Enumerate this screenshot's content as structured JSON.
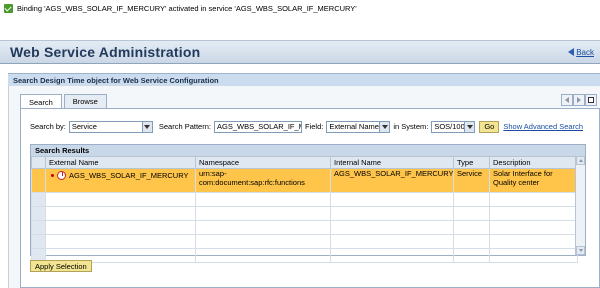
{
  "status": {
    "message": "Binding 'AGS_WBS_SOLAR_IF_MERCURY' activated in service 'AGS_WBS_SOLAR_IF_MERCURY'"
  },
  "header": {
    "title": "Web Service Administration",
    "back_label": "Back"
  },
  "section": {
    "title": "Search Design Time object for Web Service Configuration"
  },
  "tabs": [
    {
      "label": "Search"
    },
    {
      "label": "Browse"
    }
  ],
  "search": {
    "search_by_label": "Search by:",
    "search_by_value": "Service",
    "pattern_label": "Search Pattern:",
    "pattern_value": "AGS_WBS_SOLAR_IF_M",
    "field_label": "Field:",
    "field_value": "External Name",
    "system_label": "in System:",
    "system_value": "SOS/100",
    "go_label": "Go",
    "advanced_label": "Show Advanced Search"
  },
  "results": {
    "title": "Search Results",
    "columns": [
      "External Name",
      "Namespace",
      "Internal Name",
      "Type",
      "Description"
    ],
    "rows": [
      {
        "external_name": "AGS_WBS_SOLAR_IF_MERCURY",
        "namespace": "urn:sap-com:document:sap:rfc:functions",
        "internal_name": "AGS_WBS_SOLAR_IF_MERCURY",
        "type": "Service",
        "description": "Solar Interface for Quality center"
      }
    ]
  },
  "apply_label": "Apply Selection",
  "colors": {
    "selected_row": "#ffc44a",
    "button_bg": "#f2e490",
    "title_text": "#223a5c"
  }
}
